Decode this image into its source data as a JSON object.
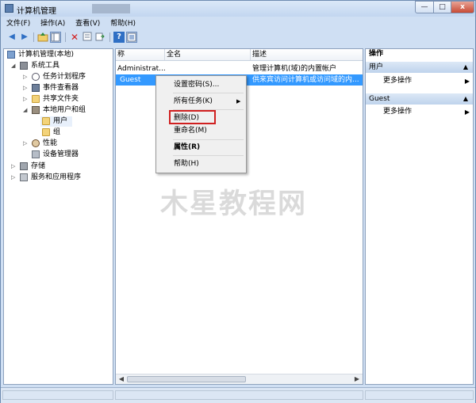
{
  "window": {
    "title": "计算机管理"
  },
  "titlebar_buttons": {
    "minimize": "—",
    "maximize": "□",
    "close": "x"
  },
  "menubar": [
    "文件(F)",
    "操作(A)",
    "查看(V)",
    "帮助(H)"
  ],
  "toolbar": [
    "back-icon",
    "forward-icon",
    "up-icon",
    "show-tree-icon",
    "delete-icon",
    "properties-icon",
    "export-icon",
    "help-icon",
    "console-icon"
  ],
  "tree": {
    "root": "计算机管理(本地)",
    "system_tools": "系统工具",
    "task_scheduler": "任务计划程序",
    "event_viewer": "事件查看器",
    "shared_folders": "共享文件夹",
    "local_users_groups": "本地用户和组",
    "users": "用户",
    "groups": "组",
    "performance": "性能",
    "device_manager": "设备管理器",
    "storage": "存储",
    "services_apps": "服务和应用程序"
  },
  "list": {
    "headers": [
      "称",
      "全名",
      "描述"
    ],
    "rows": [
      {
        "name": "Administrat...",
        "fullname": "",
        "desc": "管理计算机(域)的内置帐户"
      },
      {
        "name": "Guest",
        "fullname": "",
        "desc": "供来宾访问计算机或访问域的内..."
      }
    ]
  },
  "context_menu": {
    "set_password": "设置密码(S)...",
    "all_tasks": "所有任务(K)",
    "delete": "删除(D)",
    "rename": "重命名(M)",
    "properties": "属性(R)",
    "help": "帮助(H)"
  },
  "actions": {
    "header": "操作",
    "section1": "用户",
    "more1": "更多操作",
    "section2": "Guest",
    "more2": "更多操作"
  },
  "watermark": "木星教程网",
  "colors": {
    "selection": "#3399ff",
    "highlight_border": "#d02020"
  }
}
